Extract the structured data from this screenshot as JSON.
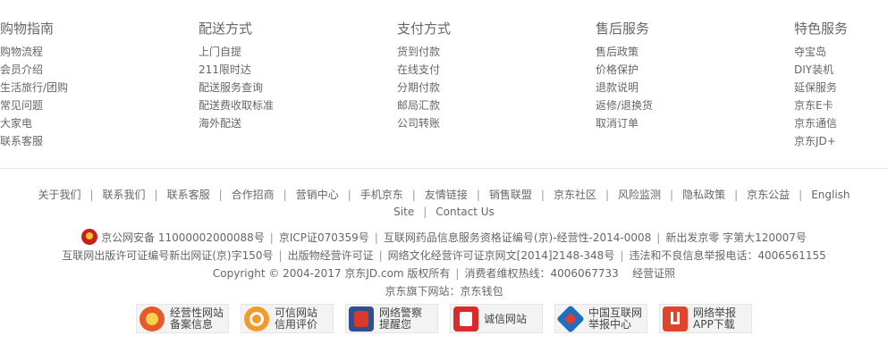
{
  "help_columns": [
    {
      "title": "购物指南",
      "items": [
        "购物流程",
        "会员介绍",
        "生活旅行/团购",
        "常见问题",
        "大家电",
        "联系客服"
      ]
    },
    {
      "title": "配送方式",
      "items": [
        "上门自提",
        "211限时达",
        "配送服务查询",
        "配送费收取标准",
        "海外配送"
      ]
    },
    {
      "title": "支付方式",
      "items": [
        "货到付款",
        "在线支付",
        "分期付款",
        "邮局汇款",
        "公司转账"
      ]
    },
    {
      "title": "售后服务",
      "items": [
        "售后政策",
        "价格保护",
        "退款说明",
        "返修/退换货",
        "取消订单"
      ]
    },
    {
      "title": "特色服务",
      "items": [
        "夺宝岛",
        "DIY装机",
        "延保服务",
        "京东E卡",
        "京东通信",
        "京东JD+"
      ]
    }
  ],
  "footer_links": {
    "row1": [
      "关于我们",
      "联系我们",
      "联系客服",
      "合作招商",
      "营销中心",
      "手机京东",
      "友情链接",
      "销售联盟",
      "京东社区",
      "风险监测",
      "隐私政策",
      "京东公益",
      "English"
    ],
    "row2": [
      "Site",
      "Contact Us"
    ],
    "separator": "|"
  },
  "info": {
    "line1": [
      "京公网安备 11000002000088号",
      "京ICP证070359号",
      "互联网药品信息服务资格证编号(京)-经营性-2014-0008",
      "新出发京零 字第大120007号"
    ],
    "line2": [
      "互联网出版许可证编号新出网证(京)字150号",
      "出版物经营许可证",
      "网络文化经营许可证京网文[2014]2148-348号",
      "违法和不良信息举报电话：4006561155"
    ],
    "copyright": "Copyright © 2004-2017  京东JD.com 版权所有",
    "hotline": "消费者维权热线：4006067733",
    "license": "经营证照",
    "subsites": "京东旗下网站：京东钱包"
  },
  "certs": [
    {
      "line1": "经营性网站",
      "line2": "备案信息",
      "icon": "police-badge-icon"
    },
    {
      "line1": "可信网站",
      "line2": "信用评价",
      "icon": "credit-seal-icon"
    },
    {
      "line1": "网络警察",
      "line2": "提醒您",
      "icon": "police-officer-icon"
    },
    {
      "line1": "诚信网站",
      "line2": "",
      "icon": "integrity-icon"
    },
    {
      "line1": "中国互联网",
      "line2": "举报中心",
      "icon": "report-center-icon"
    },
    {
      "line1": "网络举报",
      "line2": "APP下载",
      "icon": "report-app-icon"
    }
  ]
}
